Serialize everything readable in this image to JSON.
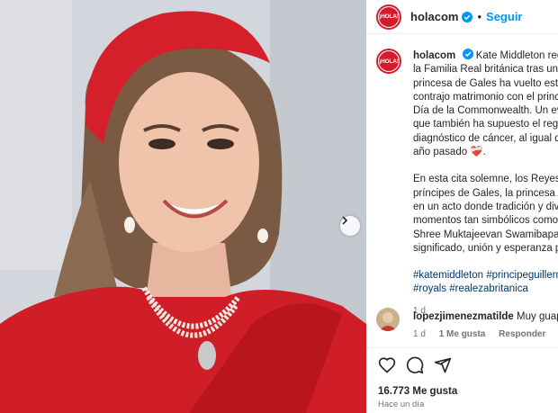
{
  "post": {
    "username": "holacom",
    "follow_label": "Seguir",
    "avatar_text": "¡HOLA!"
  },
  "caption": {
    "username": "holacom",
    "lines_p1": [
      "Kate Middleton regre",
      "la Familia Real británica tras un añ",
      "princesa de Gales ha vuelto este l",
      "contrajo matrimonio con el princi",
      "Día de la Commonwealth. Un eve",
      "que también ha supuesto el regre",
      "diagnóstico de cáncer, al igual qu",
      "año pasado ❤️‍🩹."
    ],
    "lines_p2": [
      "En esta cita solemne, los Reyes ha",
      "príncipes de Gales, la princesa An",
      "en un acto donde tradición y dive",
      "momentos tan simbólicos como l",
      "Shree Muktajeevan Swamibapa P",
      "significado, unión y esperanza pa"
    ],
    "hashtag_lines": [
      "#katemiddleton #principeguillerm",
      "#royals #realezabritanica"
    ],
    "time": "1 d"
  },
  "comment": {
    "username": "lopezjimenezmatilde",
    "text": "Muy guapa",
    "time": "1 d",
    "likes": "1 Me gusta",
    "reply": "Responder"
  },
  "engagement": {
    "likes": "16.773 Me gusta",
    "posted": "Hace un día"
  },
  "colors": {
    "brand_red": "#d41c2c",
    "link_blue": "#0095f6",
    "hashtag": "#00376b"
  },
  "icons": [
    "verified-badge-icon",
    "heart-icon",
    "comment-icon",
    "share-icon",
    "chevron-right-icon"
  ]
}
